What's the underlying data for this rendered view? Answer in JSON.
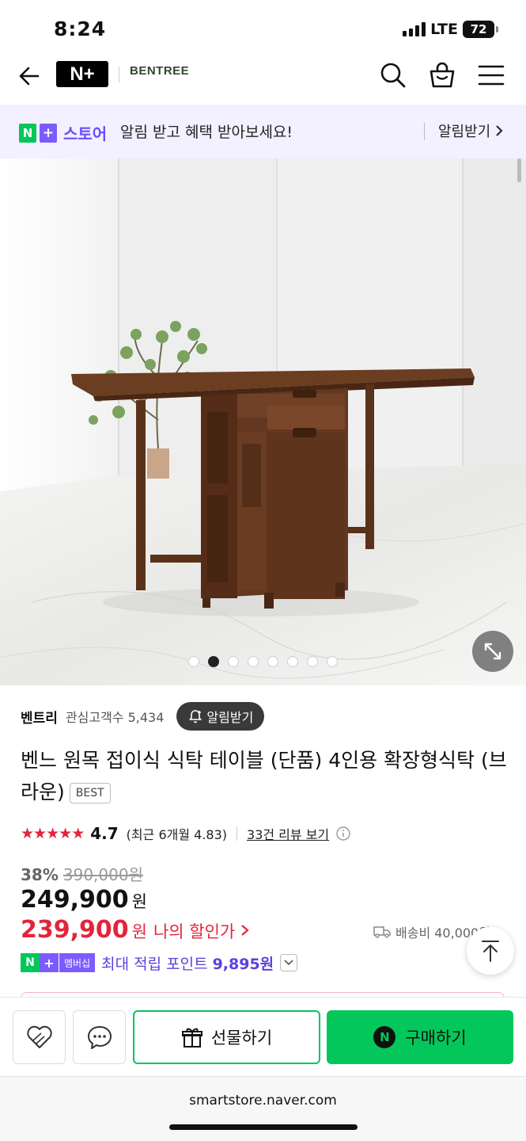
{
  "status_bar": {
    "time": "8:24",
    "network": "LTE",
    "battery": "72"
  },
  "header": {
    "platform_logo": "N+",
    "brand_logo": "BENTREE",
    "brand_tagline": "",
    "icons": [
      "back-icon",
      "search-icon",
      "shopping-bag-icon",
      "menu-icon"
    ]
  },
  "banner": {
    "logo_n": "N",
    "logo_plus": "+",
    "store_label": "스토어",
    "message": "알림 받고 혜택 받아보세요!",
    "action": "알림받기"
  },
  "gallery": {
    "total_images": 8,
    "active_index": 1
  },
  "seller": {
    "name": "벤트리",
    "interest_label": "관심고객수 5,434",
    "alarm_button": "알림받기"
  },
  "product": {
    "title": "벤느 원목 접이식 식탁 테이블 (단품) 4인용 확장형식탁 (브라운)",
    "badge": "BEST",
    "rating_stars": 4.7,
    "rating": "4.7",
    "recent_rating": "(최근 6개월 4.83)",
    "review_link": "33건 리뷰 보기",
    "discount": "38%",
    "original_price": "390,000원",
    "price": "249,900",
    "price_unit": "원",
    "my_price": "239,900",
    "my_price_unit": "원",
    "my_price_label": "나의 할인가",
    "shipping": "배송비 40,000원",
    "membership": {
      "badge_n": "N",
      "badge_plus": "+",
      "badge_label": "멤버십",
      "text": "최대 적립 포인트",
      "points": "9,895원"
    }
  },
  "bottom_bar": {
    "gift_button": "선물하기",
    "buy_badge": "N",
    "buy_button": "구매하기"
  },
  "browser": {
    "url": "smartstore.naver.com"
  },
  "colors": {
    "naver_green": "#03c75a",
    "membership_purple": "#7b5bff",
    "price_red": "#e3243b",
    "wood_brown": "#5a3219"
  }
}
